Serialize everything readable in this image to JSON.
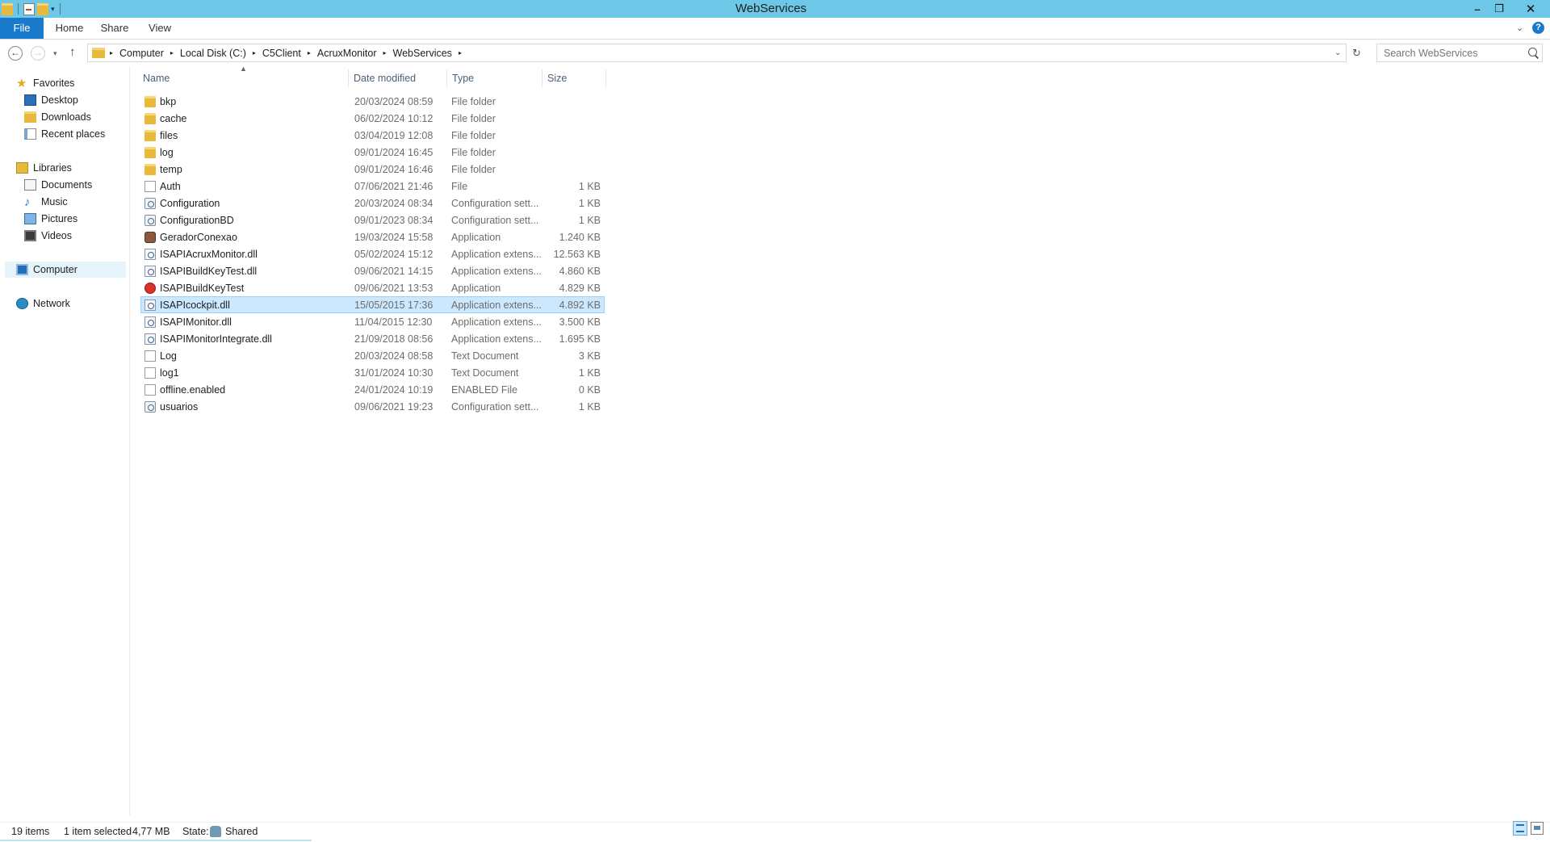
{
  "window": {
    "title": "WebServices"
  },
  "quick_access": {
    "dropdown_glyph": "▾",
    "icons": [
      "folder-icon",
      "properties-icon",
      "new-folder-icon"
    ]
  },
  "window_controls": {
    "minimize": "–",
    "maximize": "❐",
    "close": "✕"
  },
  "ribbon": {
    "tabs": [
      "File",
      "Home",
      "Share",
      "View"
    ],
    "expand_glyph": "⌄",
    "help_glyph": "?"
  },
  "nav": {
    "back_glyph": "←",
    "forward_glyph": "→",
    "recent_glyph": "▾",
    "up_glyph": "↑"
  },
  "address": {
    "breadcrumbs": [
      "Computer",
      "Local Disk (C:)",
      "C5Client",
      "AcruxMonitor",
      "WebServices"
    ],
    "sep_glyph": "▸",
    "dropdown_glyph": "⌄",
    "refresh_glyph": "↻"
  },
  "search": {
    "placeholder": "Search WebServices"
  },
  "navpane": {
    "favorites": "Favorites",
    "desktop": "Desktop",
    "downloads": "Downloads",
    "recent_places": "Recent places",
    "libraries": "Libraries",
    "documents": "Documents",
    "music": "Music",
    "pictures": "Pictures",
    "videos": "Videos",
    "computer": "Computer",
    "network": "Network",
    "star_glyph": "★",
    "music_glyph": "♪"
  },
  "columns": {
    "name": "Name",
    "date": "Date modified",
    "type": "Type",
    "size": "Size",
    "sort_glyph": "▲"
  },
  "files": [
    {
      "name": "bkp",
      "date": "20/03/2024 08:59",
      "type": "File folder",
      "size": "",
      "icon": "folder"
    },
    {
      "name": "cache",
      "date": "06/02/2024 10:12",
      "type": "File folder",
      "size": "",
      "icon": "folder"
    },
    {
      "name": "files",
      "date": "03/04/2019 12:08",
      "type": "File folder",
      "size": "",
      "icon": "folder"
    },
    {
      "name": "log",
      "date": "09/01/2024 16:45",
      "type": "File folder",
      "size": "",
      "icon": "folder"
    },
    {
      "name": "temp",
      "date": "09/01/2024 16:46",
      "type": "File folder",
      "size": "",
      "icon": "folder"
    },
    {
      "name": "Auth",
      "date": "07/06/2021 21:46",
      "type": "File",
      "size": "1 KB",
      "icon": "file"
    },
    {
      "name": "Configuration",
      "date": "20/03/2024 08:34",
      "type": "Configuration sett...",
      "size": "1 KB",
      "icon": "config"
    },
    {
      "name": "ConfigurationBD",
      "date": "09/01/2023 08:34",
      "type": "Configuration sett...",
      "size": "1 KB",
      "icon": "config"
    },
    {
      "name": "GeradorConexao",
      "date": "19/03/2024 15:58",
      "type": "Application",
      "size": "1.240 KB",
      "icon": "appbrown"
    },
    {
      "name": "ISAPIAcruxMonitor.dll",
      "date": "05/02/2024 15:12",
      "type": "Application extens...",
      "size": "12.563 KB",
      "icon": "dll"
    },
    {
      "name": "ISAPIBuildKeyTest.dll",
      "date": "09/06/2021 14:15",
      "type": "Application extens...",
      "size": "4.860 KB",
      "icon": "dll"
    },
    {
      "name": "ISAPIBuildKeyTest",
      "date": "09/06/2021 13:53",
      "type": "Application",
      "size": "4.829 KB",
      "icon": "appred"
    },
    {
      "name": "ISAPIcockpit.dll",
      "date": "15/05/2015 17:36",
      "type": "Application extens...",
      "size": "4.892 KB",
      "icon": "dll",
      "selected": true
    },
    {
      "name": "ISAPIMonitor.dll",
      "date": "11/04/2015 12:30",
      "type": "Application extens...",
      "size": "3.500 KB",
      "icon": "dll"
    },
    {
      "name": "ISAPIMonitorIntegrate.dll",
      "date": "21/09/2018 08:56",
      "type": "Application extens...",
      "size": "1.695 KB",
      "icon": "dll"
    },
    {
      "name": "Log",
      "date": "20/03/2024 08:58",
      "type": "Text Document",
      "size": "3 KB",
      "icon": "text"
    },
    {
      "name": "log1",
      "date": "31/01/2024 10:30",
      "type": "Text Document",
      "size": "1 KB",
      "icon": "text"
    },
    {
      "name": "offline.enabled",
      "date": "24/01/2024 10:19",
      "type": "ENABLED File",
      "size": "0 KB",
      "icon": "file"
    },
    {
      "name": "usuarios",
      "date": "09/06/2021 19:23",
      "type": "Configuration sett...",
      "size": "1 KB",
      "icon": "config"
    }
  ],
  "status": {
    "items": "19 items",
    "selected": "1 item selected",
    "size": "4,77 MB",
    "state_label": "State:",
    "state_value": "Shared"
  },
  "colors": {
    "titlebar": "#6cc8e6",
    "file_tab": "#1979ca",
    "selection": "#cce8ff"
  }
}
